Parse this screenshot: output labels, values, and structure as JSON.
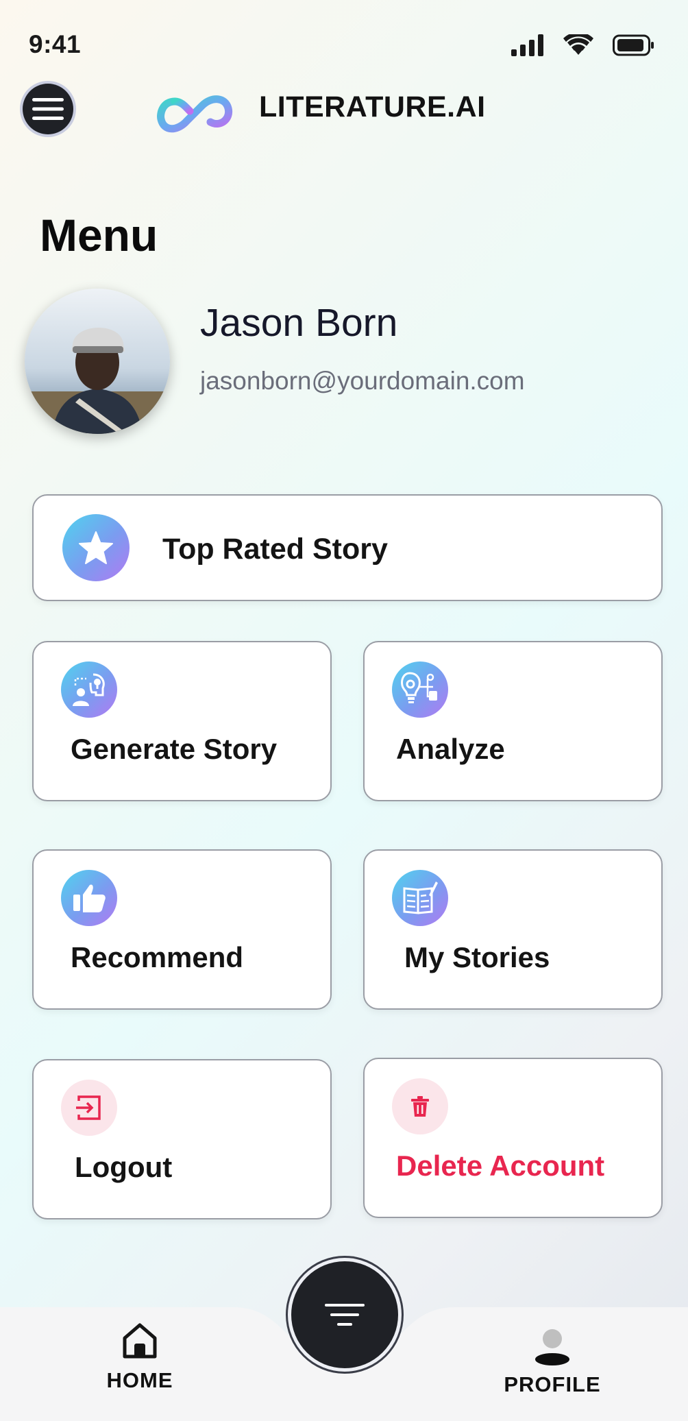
{
  "status_bar": {
    "time": "9:41"
  },
  "header": {
    "brand": "LITERATURE.AI"
  },
  "menu": {
    "title": "Menu"
  },
  "profile": {
    "name": "Jason Born",
    "email": "jasonborn@yourdomain.com"
  },
  "cards": {
    "top_rated": {
      "label": "Top Rated Story",
      "icon": "star-icon"
    },
    "generate": {
      "label": "Generate Story",
      "icon": "idea-person-icon"
    },
    "analyze": {
      "label": "Analyze",
      "icon": "analysis-gear-icon"
    },
    "recommend": {
      "label": "Recommend",
      "icon": "thumbs-up-icon"
    },
    "my_stories": {
      "label": "My Stories",
      "icon": "book-pen-icon"
    },
    "logout": {
      "label": "Logout",
      "icon": "logout-icon"
    },
    "delete": {
      "label": "Delete Account",
      "icon": "trash-icon"
    }
  },
  "bottom_nav": {
    "home": "HOME",
    "profile": "PROFILE"
  },
  "colors": {
    "accent_gradient_start": "#4fd3ee",
    "accent_gradient_end": "#b17af2",
    "danger": "#e8264f",
    "dark": "#1f2126"
  }
}
